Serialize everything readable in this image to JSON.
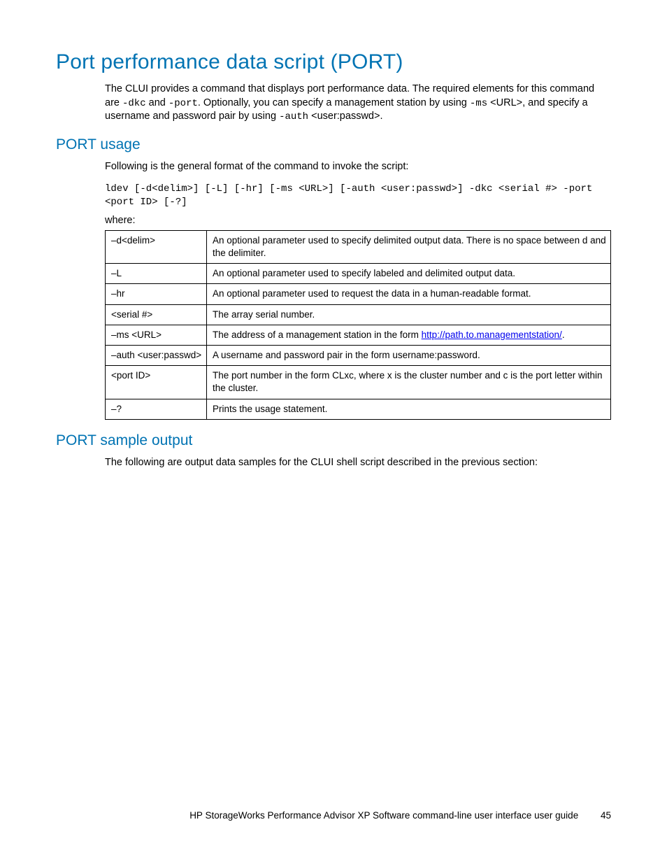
{
  "title": "Port performance data script (PORT)",
  "intro_parts": {
    "p1": "The CLUI provides a command that displays port performance data. The required elements for this command are ",
    "code1": "-dkc",
    "p2": " and ",
    "code2": "-port",
    "p3": ". Optionally, you can specify a management station by using ",
    "code3": "-ms",
    "p4": " <URL>, and specify a username and password pair by using ",
    "code4": "-auth",
    "p5": " <user:passwd>."
  },
  "usage": {
    "heading": "PORT usage",
    "lead": "Following is the general format of the command to invoke the script:",
    "code": "ldev [-d<delim>] [-L] [-hr] [-ms <URL>] [-auth <user:passwd>] -dkc <serial #> -port <port ID> [-?]",
    "where": "where:",
    "rows": [
      {
        "opt": "–d<delim>",
        "desc": "An optional parameter used to specify delimited output data. There is no space between d and the delimiter."
      },
      {
        "opt": "–L",
        "desc": "An optional parameter used to specify labeled and delimited output data."
      },
      {
        "opt": "–hr",
        "desc": "An optional parameter used to request the data in a human-readable format."
      },
      {
        "opt": "<serial #>",
        "desc": "The array serial number."
      },
      {
        "opt": "–ms <URL>",
        "desc_pre": "The address of a management station in the form ",
        "link": "http://path.to.managementstation/",
        "desc_post": "."
      },
      {
        "opt": "–auth <user:passwd>",
        "desc": "A username and password pair in the form username:password."
      },
      {
        "opt": "<port ID>",
        "desc": "The port number in the form CLxc, where x is the cluster number and c is the port letter within the cluster."
      },
      {
        "opt": "–?",
        "desc": "Prints the usage statement."
      }
    ]
  },
  "sample": {
    "heading": "PORT sample output",
    "lead": "The following are output data samples for the CLUI shell script described in the previous section:"
  },
  "footer": {
    "text": "HP StorageWorks Performance Advisor XP Software command-line user interface user guide",
    "page": "45"
  }
}
